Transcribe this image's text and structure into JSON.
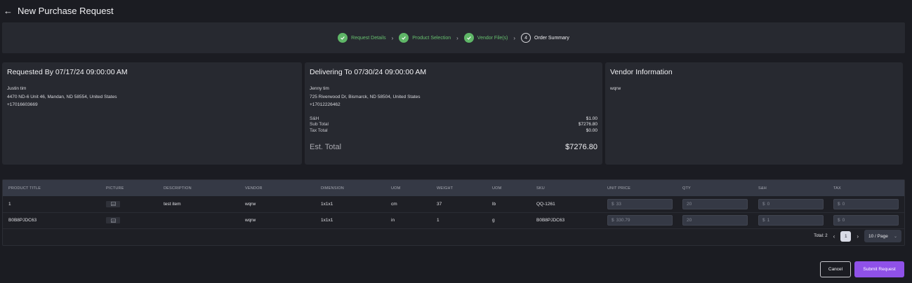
{
  "header": {
    "back_icon": "arrow-left-icon",
    "title": "New Purchase Request"
  },
  "steps": [
    {
      "label": "Request Details",
      "status": "done"
    },
    {
      "label": "Product Selection",
      "status": "done"
    },
    {
      "label": "Vendor File(s)",
      "status": "done"
    },
    {
      "label": "Order Summary",
      "status": "current",
      "number": "4"
    }
  ],
  "requested": {
    "title": "Requested By 07/17/24 09:00:00 AM",
    "name": "Justin tim",
    "address": "4470 ND-6 Unit 46, Mandan, ND 58554, United States",
    "phone": "+17016603669"
  },
  "delivering": {
    "title": "Delivering To 07/30/24 09:00:00 AM",
    "name": "Jenny tim",
    "address": "725 Riverwood Dr, Bismarck, ND 58504, United States",
    "phone": "+17012226462",
    "sh_label": "S&H",
    "sh_value": "$1.00",
    "subtotal_label": "Sub Total",
    "subtotal_value": "$7276.80",
    "tax_label": "Tax Total",
    "tax_value": "$0.00",
    "est_label": "Est. Total",
    "est_value": "$7276.80"
  },
  "vendor": {
    "title": "Vendor Information",
    "name": "wqrw"
  },
  "table": {
    "columns": [
      "PRODUCT TITLE",
      "PICTURE",
      "DESCRIPTION",
      "VENDOR",
      "DIMENSION",
      "UOM",
      "WEIGHT",
      "UOM",
      "SKU",
      "UNIT PRICE",
      "QTY",
      "S&H",
      "TAX"
    ],
    "rows": [
      {
        "title": "1",
        "description": "test item",
        "vendor": "wqrw",
        "dimension": "1x1x1",
        "uom": "cm",
        "weight": "37",
        "weight_uom": "lb",
        "sku": "QQ-1261",
        "currency": "$",
        "unit_price": "33",
        "qty": "20",
        "sh": "0",
        "tax": "0"
      },
      {
        "title": "B0B8PJDC63",
        "description": "",
        "vendor": "wqrw",
        "dimension": "1x1x1",
        "uom": "in",
        "weight": "1",
        "weight_uom": "g",
        "sku": "B0B8PJDC63",
        "currency": "$",
        "unit_price": "330.79",
        "qty": "20",
        "sh": "1",
        "tax": "0"
      }
    ]
  },
  "pagination": {
    "total": "Total: 2",
    "page": "1",
    "page_size": "10 / Page"
  },
  "actions": {
    "cancel": "Cancel",
    "submit": "Submit Request"
  },
  "colors": {
    "accent": "#8f51e8",
    "success": "#5fb667",
    "background": "#1b1c22",
    "card": "#272930"
  }
}
